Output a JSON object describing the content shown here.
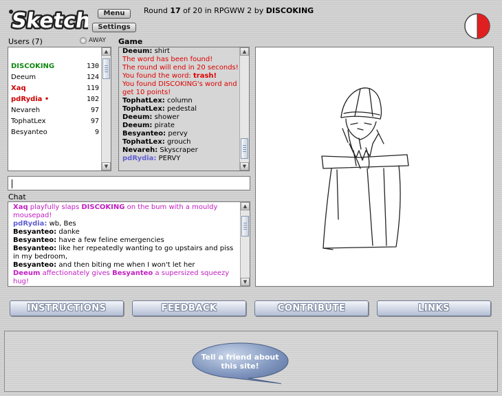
{
  "header": {
    "menu_label": "Menu",
    "settings_label": "Settings",
    "round_prefix": "Round ",
    "round_number": "17",
    "round_middle": " of 20 in RPGWW 2 by ",
    "round_artist": "DISCOKING",
    "logo_text": "Sketch"
  },
  "users": {
    "label": "Users (7)",
    "away_label": "AWAY",
    "list": [
      {
        "name": "DISCOKING",
        "score": "130"
      },
      {
        "name": "Deeum",
        "score": "124"
      },
      {
        "name": "Xaq",
        "score": "119"
      },
      {
        "name": "pdRydia •",
        "score": "102"
      },
      {
        "name": "Nevareh",
        "score": "97"
      },
      {
        "name": "TophatLex",
        "score": "97"
      },
      {
        "name": "Besyanteo",
        "score": "9"
      }
    ]
  },
  "game": {
    "label": "Game",
    "log": [
      {
        "who": "Deeum:",
        "text": " shirt"
      },
      {
        "sys": "The word has been found!"
      },
      {
        "sys": "The round will end in 20 seconds!"
      },
      {
        "sys": "You found the word: ",
        "bold": "trash!"
      },
      {
        "sys": "You found DISCOKING's word and get 10 points!"
      },
      {
        "who": "TophatLex:",
        "text": " column"
      },
      {
        "who": "TophatLex:",
        "text": " pedestal"
      },
      {
        "who": "Deeum:",
        "text": " shower"
      },
      {
        "who": "Deeum:",
        "text": " pirate"
      },
      {
        "who": "Besyanteo:",
        "text": " pervy"
      },
      {
        "who": "TophatLex:",
        "text": " grouch"
      },
      {
        "who": "Nevareh:",
        "text": " Skyscraper"
      },
      {
        "who": "pdRydia:",
        "text": " PERVY"
      }
    ]
  },
  "chat": {
    "label": "Chat",
    "input_value": "",
    "log": [
      {
        "emote_who": "Xaq",
        "emote_a": " playfully slaps ",
        "emote_target": "DISCOKING",
        "emote_b": " on the bum with a mouldy mousepad!"
      },
      {
        "who": "pdRydia:",
        "text": " wb, Bes"
      },
      {
        "who": "Besyanteo:",
        "text": " danke"
      },
      {
        "who": "Besyanteo:",
        "text": " have a few feline emergencies"
      },
      {
        "who": "Besyanteo:",
        "text": " like her repeatedly wanting to go upstairs and piss in my bedroom,"
      },
      {
        "who": "Besyanteo:",
        "text": " and then biting me when I won't let her"
      },
      {
        "emote_who": "Deeum",
        "emote_a": " affectionately gives ",
        "emote_target": "Besyanteo",
        "emote_b": " a supersized squeezy hug!"
      }
    ]
  },
  "nav": {
    "instructions": "INSTRUCTIONS",
    "feedback": "FEEDBACK",
    "contribute": "CONTRIBUTE",
    "links": "LINKS"
  },
  "promo": {
    "tell_friend": "Tell a friend about this site!"
  },
  "colors": {
    "drawer": "#118811",
    "system": "#dd0000",
    "emote": "#c020c0",
    "timer_red": "#e02020"
  },
  "timer": {
    "remaining_fraction": 0.5
  }
}
